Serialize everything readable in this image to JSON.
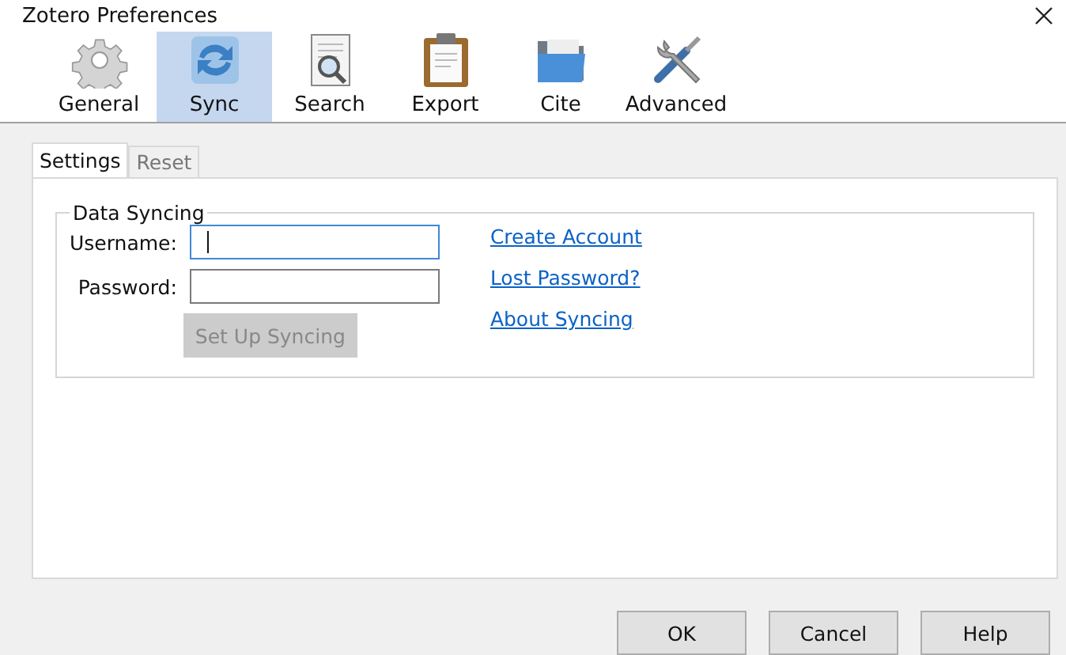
{
  "window": {
    "title": "Zotero Preferences"
  },
  "toolbar": [
    {
      "label": "General",
      "kind": "gear",
      "selected": false
    },
    {
      "label": "Sync",
      "kind": "sync",
      "selected": true
    },
    {
      "label": "Search",
      "kind": "search",
      "selected": false
    },
    {
      "label": "Export",
      "kind": "clipboard",
      "selected": false
    },
    {
      "label": "Cite",
      "kind": "folder",
      "selected": false
    },
    {
      "label": "Advanced",
      "kind": "tools",
      "selected": false
    }
  ],
  "tabs": [
    {
      "label": "Settings",
      "selected": true
    },
    {
      "label": "Reset",
      "selected": false
    }
  ],
  "group": {
    "title": "Data Syncing",
    "fields": [
      {
        "label": "Username:",
        "focused": true
      },
      {
        "label": "Password:",
        "focused": false
      }
    ],
    "button": {
      "label": "Set Up Syncing",
      "disabled": true
    },
    "links": [
      "Create Account",
      "Lost Password?",
      "About Syncing"
    ]
  },
  "buttons": [
    "OK",
    "Cancel",
    "Help"
  ]
}
